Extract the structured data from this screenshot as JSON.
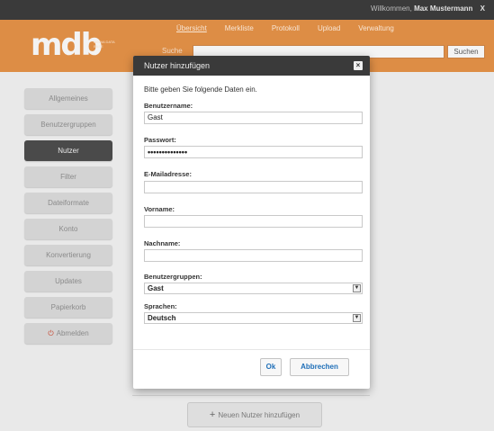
{
  "topbar": {
    "welcome_prefix": "Willkommen,",
    "user_name": "Max Mustermann",
    "close_label": "X"
  },
  "header": {
    "logo_text": "mdb",
    "logo_sub": "MEDIA DATA BASE",
    "nav": [
      "Übersicht",
      "Merkliste",
      "Protokoll",
      "Upload",
      "Verwaltung"
    ],
    "search_label": "Suche",
    "search_value": "",
    "search_button": "Suchen"
  },
  "sidebar": {
    "items": [
      {
        "label": "Allgemeines"
      },
      {
        "label": "Benutzergruppen"
      },
      {
        "label": "Nutzer"
      },
      {
        "label": "Filter"
      },
      {
        "label": "Dateiformate"
      },
      {
        "label": "Konto"
      },
      {
        "label": "Konvertierung"
      },
      {
        "label": "Updates"
      },
      {
        "label": "Papierkorb"
      },
      {
        "label": "Abmelden"
      }
    ]
  },
  "add_user_button": {
    "plus": "+",
    "label": "Neuen Nutzer hinzufügen"
  },
  "modal": {
    "title": "Nutzer hinzufügen",
    "close": "×",
    "intro": "Bitte geben Sie folgende Daten ein.",
    "fields": {
      "username": {
        "label": "Benutzername:",
        "value": "Gast"
      },
      "password": {
        "label": "Passwort:",
        "value": "••••••••••••••"
      },
      "email": {
        "label": "E-Mailadresse:",
        "value": ""
      },
      "firstname": {
        "label": "Vorname:",
        "value": ""
      },
      "lastname": {
        "label": "Nachname:",
        "value": ""
      },
      "groups": {
        "label": "Benutzergruppen:",
        "value": "Gast"
      },
      "language": {
        "label": "Sprachen:",
        "value": "Deutsch"
      }
    },
    "ok": "Ok",
    "cancel": "Abbrechen"
  },
  "colors": {
    "header_orange": "#dd8d45",
    "dark_bar": "#3a3a3a",
    "link_blue": "#1f6fb8",
    "logout_red": "#c64028"
  }
}
